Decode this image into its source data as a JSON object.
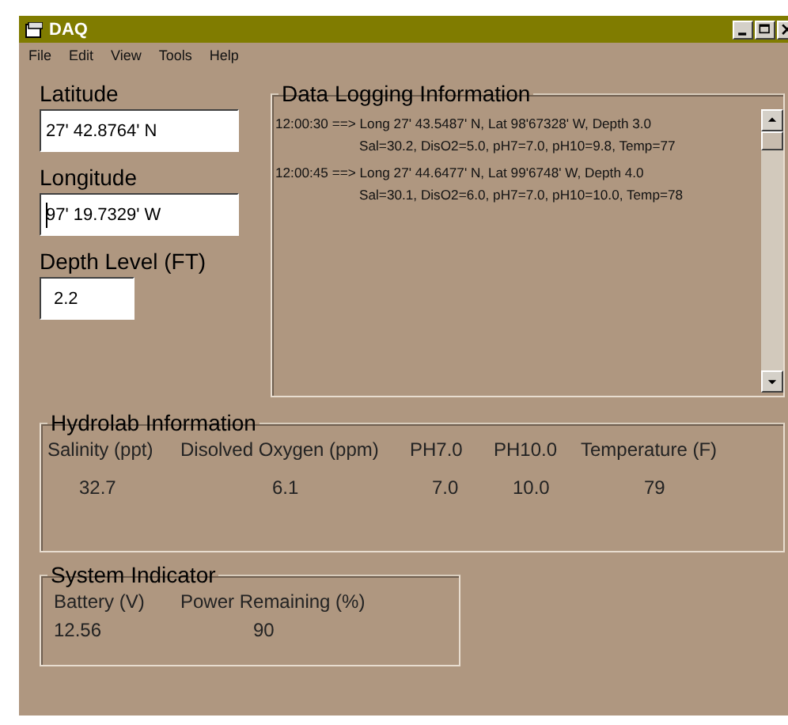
{
  "window": {
    "title": "DAQ"
  },
  "menu": [
    "File",
    "Edit",
    "View",
    "Tools",
    "Help"
  ],
  "fields": [
    {
      "label": "Latitude",
      "value": "27' 42.8764' N",
      "kind": "wide"
    },
    {
      "label": "Longitude",
      "value": "97' 19.7329' W",
      "kind": "wide",
      "focused": true
    },
    {
      "label": "Depth Level (FT)",
      "value": "2.2",
      "kind": "narrow"
    }
  ],
  "log": {
    "title": "Data Logging Information",
    "entries": [
      {
        "line_1": "12:00:30 ==> Long 27' 43.5487' N,  Lat 98'67328' W, Depth 3.0",
        "line_2": "Sal=30.2, DisO2=5.0, pH7=7.0, pH10=9.8, Temp=77"
      },
      {
        "line_1": "12:00:45 ==> Long 27' 44.6477' N,  Lat 99'6748' W, Depth 4.0",
        "line_2": "Sal=30.1, DisO2=6.0, pH7=7.0, pH10=10.0, Temp=78"
      }
    ]
  },
  "hydrolab": {
    "title": "Hydrolab Information",
    "columns": [
      {
        "label": "Salinity (ppt)",
        "value": "32.7"
      },
      {
        "label": "Disolved Oxygen (ppm)",
        "value": "6.1"
      },
      {
        "label": "PH7.0",
        "value": "7.0"
      },
      {
        "label": "PH10.0",
        "value": "10.0"
      },
      {
        "label": "Temperature (F)",
        "value": "79"
      }
    ]
  },
  "system": {
    "title": "System Indicator",
    "columns": [
      {
        "label": "Battery (V)",
        "value": "12.56"
      },
      {
        "label": "Power Remaining (%)",
        "value": "90"
      }
    ]
  }
}
